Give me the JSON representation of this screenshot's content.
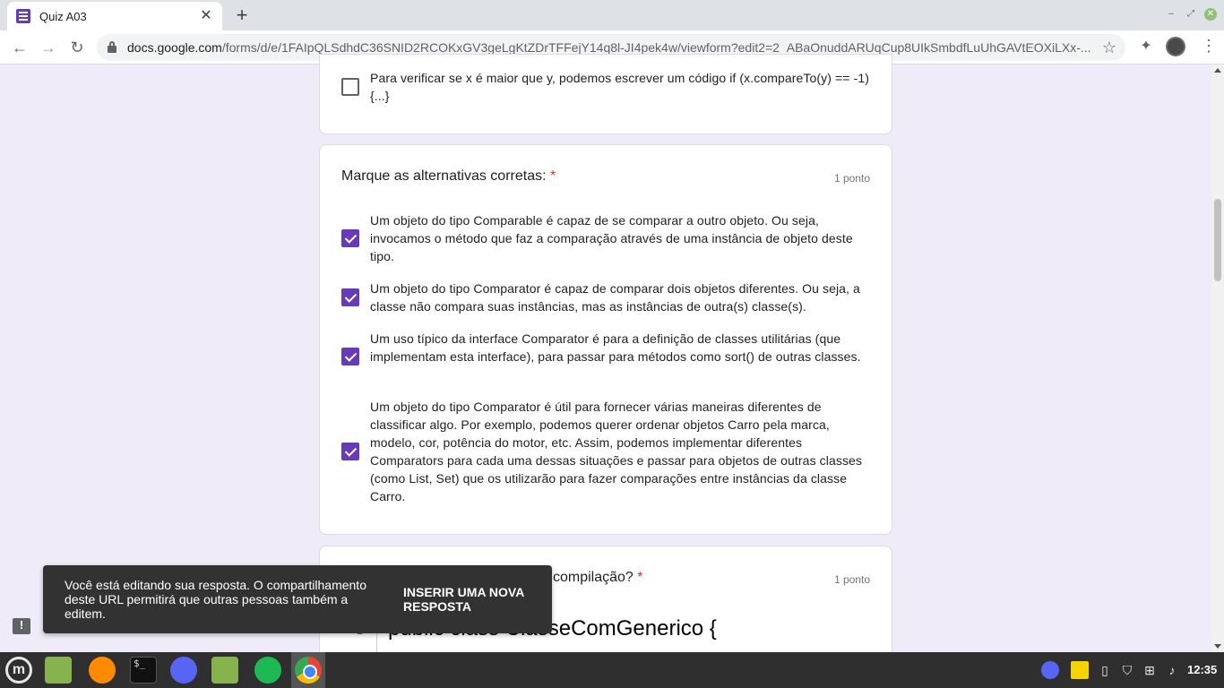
{
  "browser": {
    "tab_title": "Quiz A03",
    "tab_close": "✕",
    "new_tab": "+",
    "url_domain": "docs.google.com",
    "url_path": "/forms/d/e/1FAIpQLSdhdC36SNID2RCOKxGV3geLgKtZDrTFFejY14q8l-JI4pek4w/viewform?edit2=2_ABaOnuddARUqCup8UIkSmbdfLuUhGAVtEOXiLXx-..."
  },
  "previous_question": {
    "option_text": "Para verificar se x é maior que y, podemos escrever um código if (x.compareTo(y) == -1) {...}",
    "checked": false
  },
  "question": {
    "title": "Marque as alternativas corretas:",
    "required_mark": "*",
    "points": "1 ponto",
    "options": [
      {
        "text": "Um objeto do tipo Comparable é capaz de se comparar a outro objeto. Ou seja, invocamos o método que faz a comparação através de uma instância de objeto deste tipo.",
        "checked": true
      },
      {
        "text": "Um objeto do tipo Comparator é capaz de comparar dois objetos diferentes. Ou seja, a classe não compara suas instâncias, mas as instâncias de outra(s) classe(s).",
        "checked": true
      },
      {
        "text": "Um uso típico da interface Comparator é para a definição de classes utilitárias (que implementam esta interface), para passar para métodos como sort() de outras classes.",
        "checked": true
      },
      {
        "text": "Um objeto do tipo Comparator é útil para fornecer várias maneiras diferentes de classificar algo. Por exemplo, podemos querer ordenar objetos Carro pela marca, modelo, cor, potência do motor, etc. Assim, podemos implementar diferentes Comparators para cada uma dessas situações e passar para objetos de outras classes (como List, Set) que os utilizarão para fazer comparações entre instâncias da classe Carro.",
        "checked": true
      }
    ]
  },
  "next_question": {
    "title_visible": "compilação?",
    "required_mark": "*",
    "points": "1 ponto",
    "code_line_number": "5",
    "code_line": "public class ClasseComGenerico {"
  },
  "snackbar": {
    "message": "Você está editando sua resposta. O compartilhamento deste URL permitirá que outras pessoas também a editem.",
    "action": "INSERIR UMA NOVA RESPOSTA"
  },
  "taskbar": {
    "mint_label": "m",
    "terminal_label": "$_",
    "clock": "12:35"
  },
  "icons": {
    "back": "←",
    "forward": "→",
    "reload": "↻",
    "star": "☆",
    "extensions": "✦",
    "menu": "⋮",
    "feedback": "!",
    "minimize": "–",
    "maximize": "⤢",
    "close": "✕"
  },
  "colors": {
    "accent": "#673ab7",
    "page_bg": "#f0ebf8",
    "required": "#d93025"
  }
}
